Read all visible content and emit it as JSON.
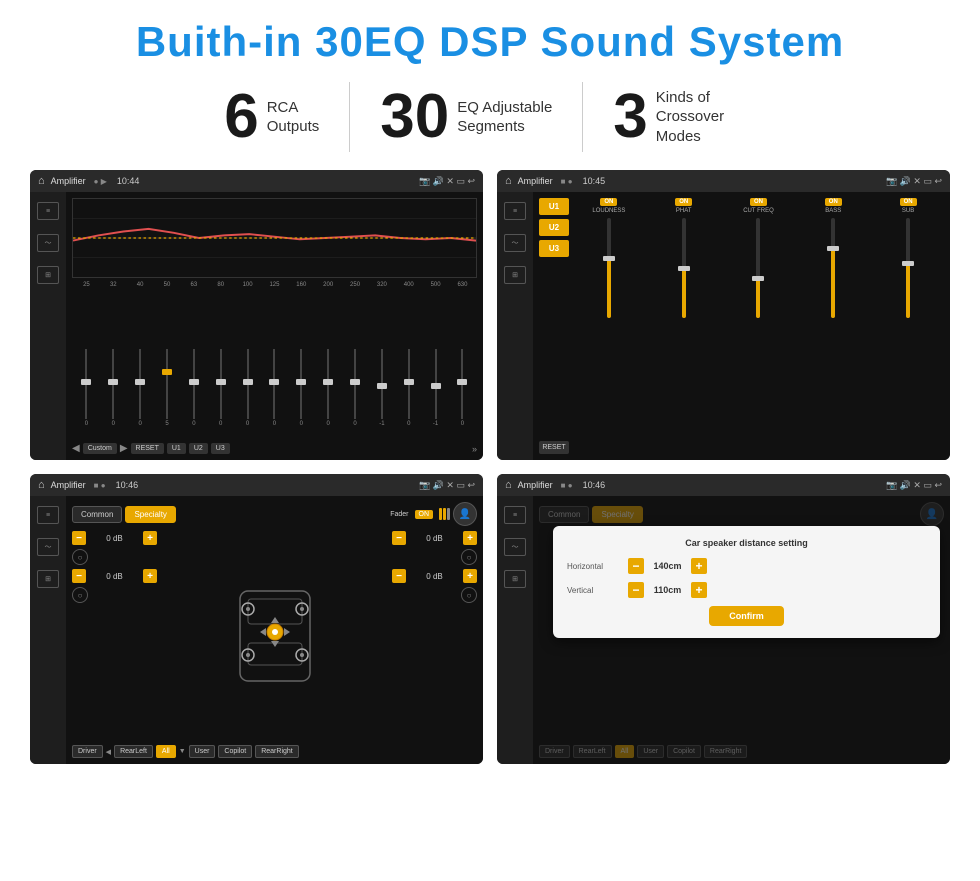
{
  "header": {
    "title": "Buith-in 30EQ DSP Sound System"
  },
  "stats": [
    {
      "number": "6",
      "text_line1": "RCA",
      "text_line2": "Outputs"
    },
    {
      "number": "30",
      "text_line1": "EQ Adjustable",
      "text_line2": "Segments"
    },
    {
      "number": "3",
      "text_line1": "Kinds of",
      "text_line2": "Crossover Modes"
    }
  ],
  "screens": {
    "eq": {
      "title": "Amplifier",
      "time": "10:44",
      "eq_labels": [
        "25",
        "32",
        "40",
        "50",
        "63",
        "80",
        "100",
        "125",
        "160",
        "200",
        "250",
        "320",
        "400",
        "500",
        "630"
      ],
      "eq_values": [
        "0",
        "0",
        "0",
        "5",
        "0",
        "0",
        "0",
        "0",
        "0",
        "0",
        "0",
        "-1",
        "0",
        "-1"
      ],
      "buttons": [
        "Custom",
        "RESET",
        "U1",
        "U2",
        "U3"
      ]
    },
    "crossover": {
      "title": "Amplifier",
      "time": "10:45",
      "channels": [
        "LOUDNESS",
        "PHAT",
        "CUT FREQ",
        "BASS",
        "SUB"
      ],
      "u_buttons": [
        "U1",
        "U2",
        "U3"
      ],
      "reset": "RESET"
    },
    "balance": {
      "title": "Amplifier",
      "time": "10:46",
      "tabs": [
        "Common",
        "Specialty"
      ],
      "fader_label": "Fader",
      "fader_on": "ON",
      "db_values": [
        "0 dB",
        "0 dB",
        "0 dB",
        "0 dB"
      ],
      "labels": [
        "Driver",
        "RearLeft",
        "All",
        "User",
        "Copilot",
        "RearRight"
      ]
    },
    "distance": {
      "title": "Amplifier",
      "time": "10:46",
      "overlay_title": "Car speaker distance setting",
      "horizontal_label": "Horizontal",
      "horizontal_value": "140cm",
      "vertical_label": "Vertical",
      "vertical_value": "110cm",
      "confirm_label": "Confirm"
    }
  }
}
